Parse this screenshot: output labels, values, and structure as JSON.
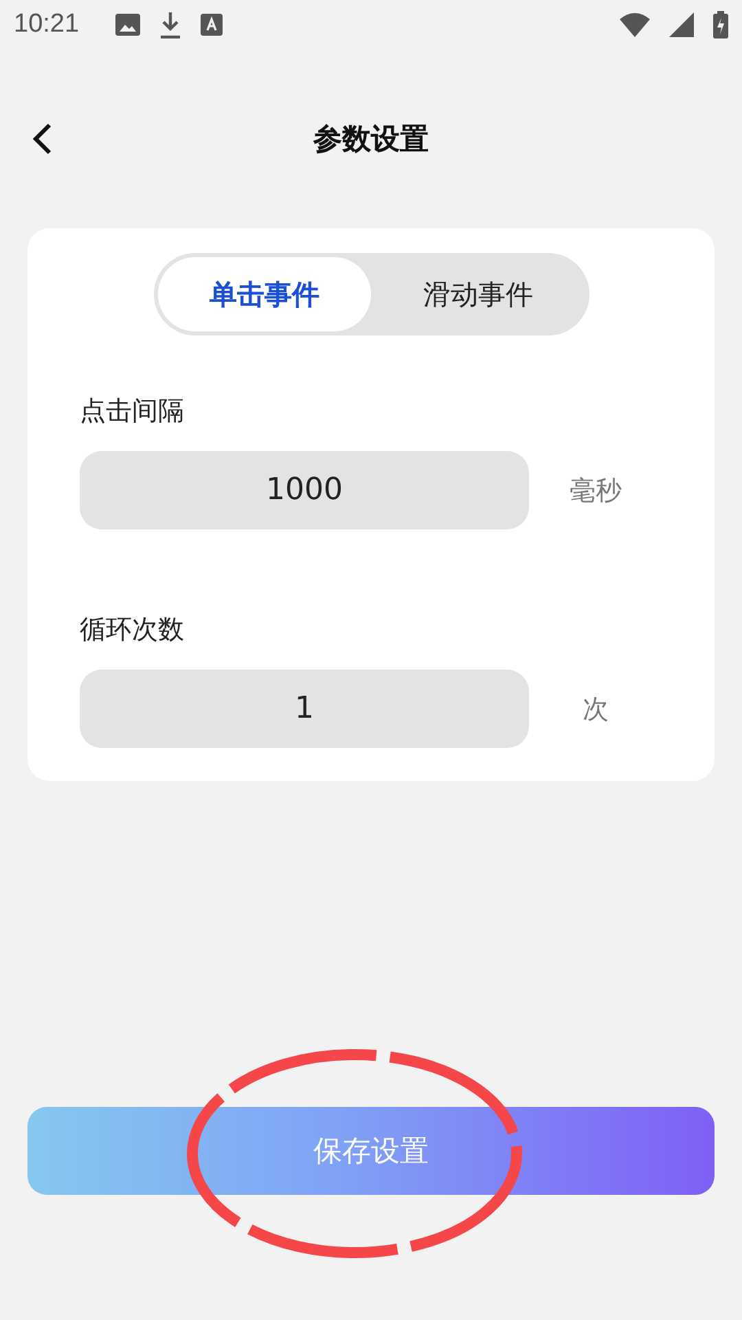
{
  "status_bar": {
    "time": "10:21"
  },
  "header": {
    "title": "参数设置"
  },
  "tabs": [
    {
      "label": "单击事件",
      "selected": true
    },
    {
      "label": "滑动事件",
      "selected": false
    }
  ],
  "fields": [
    {
      "label": "点击间隔",
      "value": "1000",
      "unit": "毫秒"
    },
    {
      "label": "循环次数",
      "value": "1",
      "unit": "次"
    }
  ],
  "save_button": {
    "label": "保存设置"
  }
}
